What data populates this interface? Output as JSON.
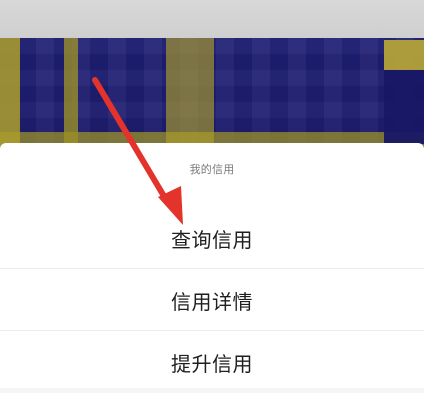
{
  "sheet": {
    "title": "我的信用",
    "items": [
      "查询信用",
      "信用详情",
      "提升信用"
    ]
  },
  "colors": {
    "background_top": "#1f1f75",
    "sheet": "#ffffff",
    "text_primary": "#1f1f1f",
    "text_secondary": "#7b7b7b",
    "arrow": "#e3332b"
  },
  "icons": {
    "annotation_arrow": "red-arrow-icon"
  }
}
